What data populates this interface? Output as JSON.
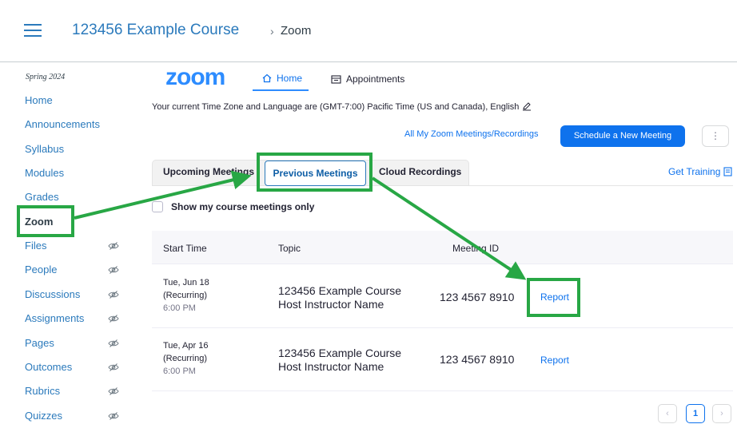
{
  "header": {
    "course_title": "123456 Example Course",
    "breadcrumb_sep": "›",
    "breadcrumb_current": "Zoom"
  },
  "sidebar": {
    "term": "Spring 2024",
    "items": [
      {
        "label": "Home",
        "hidden": false
      },
      {
        "label": "Announcements",
        "hidden": false
      },
      {
        "label": "Syllabus",
        "hidden": false
      },
      {
        "label": "Modules",
        "hidden": false
      },
      {
        "label": "Grades",
        "hidden": false
      },
      {
        "label": "Zoom",
        "hidden": false,
        "active": true
      },
      {
        "label": "Files",
        "hidden": true
      },
      {
        "label": "People",
        "hidden": true
      },
      {
        "label": "Discussions",
        "hidden": true
      },
      {
        "label": "Assignments",
        "hidden": true
      },
      {
        "label": "Pages",
        "hidden": true
      },
      {
        "label": "Outcomes",
        "hidden": true
      },
      {
        "label": "Rubrics",
        "hidden": true
      },
      {
        "label": "Quizzes",
        "hidden": true
      }
    ]
  },
  "zoom": {
    "logo": "zoom",
    "tabs": {
      "home": "Home",
      "appointments": "Appointments"
    },
    "timezone_text": "Your current Time Zone and Language are (GMT-7:00) Pacific Time (US and Canada), English",
    "all_meetings_link": "All My Zoom Meetings/Recordings",
    "schedule_button": "Schedule a New Meeting",
    "more_button": "⋮",
    "meeting_tabs": {
      "upcoming": "Upcoming Meetings",
      "previous": "Previous Meetings",
      "cloud": "Cloud Recordings"
    },
    "get_training": "Get Training",
    "checkbox_label": "Show my course meetings only",
    "table": {
      "headers": [
        "Start Time",
        "Topic",
        "Meeting ID"
      ],
      "rows": [
        {
          "date": "Tue, Jun 18",
          "recurring": "(Recurring)",
          "time": "6:00 PM",
          "topic": "123456 Example Course",
          "host": "Host Instructor Name",
          "meeting_id": "123 4567 8910",
          "action": "Report"
        },
        {
          "date": "Tue, Apr 16",
          "recurring": "(Recurring)",
          "time": "6:00 PM",
          "topic": "123456 Example Course",
          "host": "Host Instructor Name",
          "meeting_id": "123 4567 8910",
          "action": "Report"
        }
      ]
    },
    "pagination": {
      "prev": "‹",
      "current": "1",
      "next": "›"
    }
  },
  "colors": {
    "canvas_link": "#2b7abc",
    "zoom_blue": "#2d8cff",
    "annotation_green": "#28a745"
  }
}
